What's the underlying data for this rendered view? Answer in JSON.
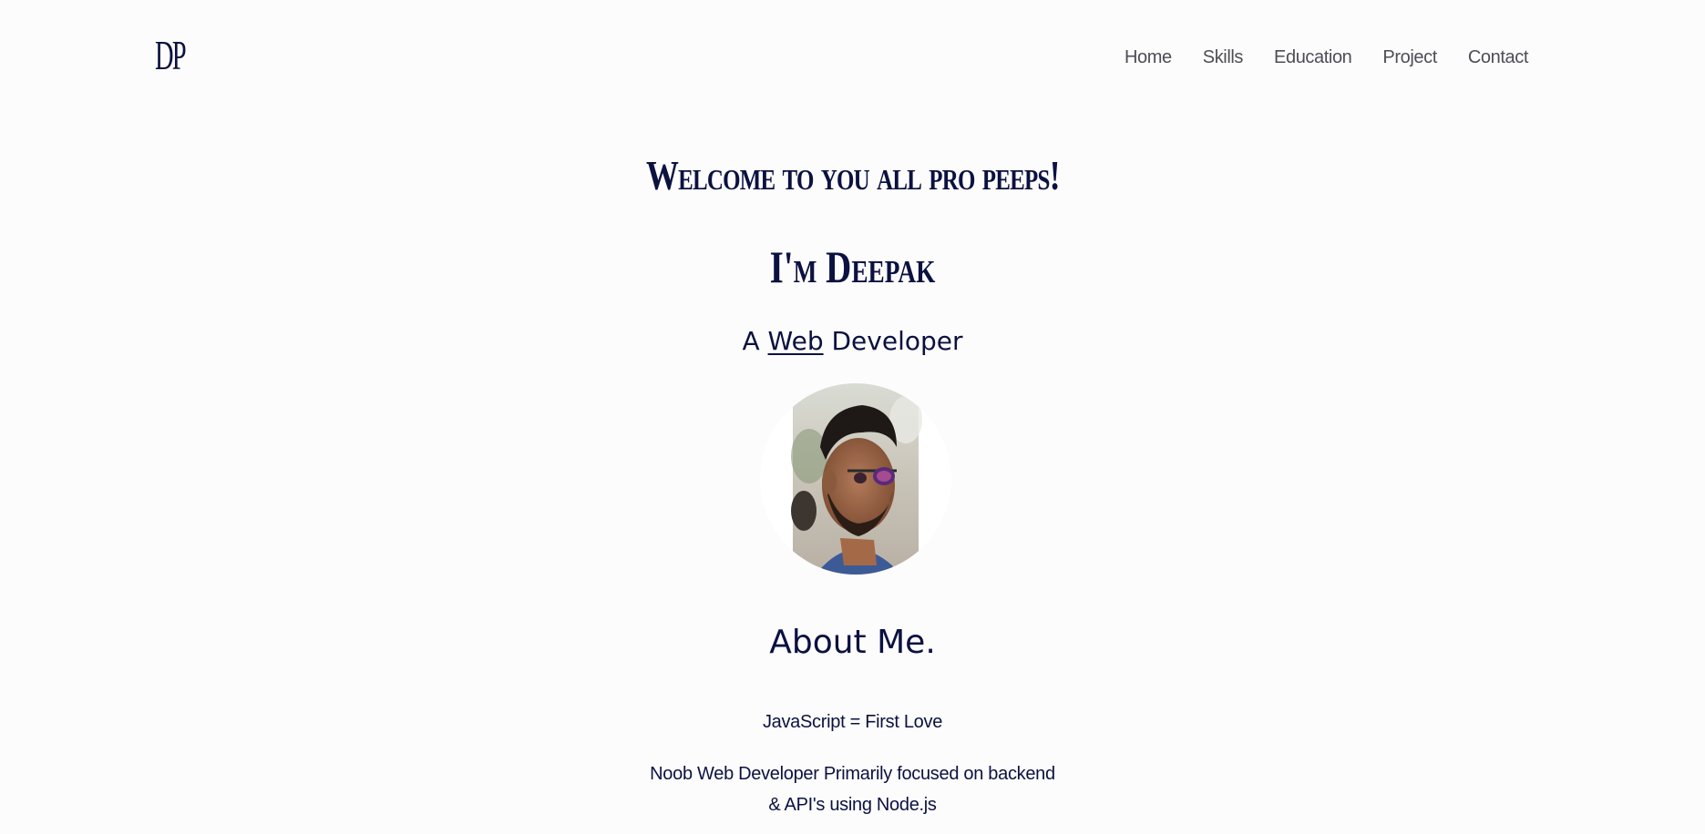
{
  "header": {
    "logo": "DP",
    "nav": [
      "Home",
      "Skills",
      "Education",
      "Project",
      "Contact"
    ]
  },
  "hero": {
    "welcome": "Welcome to you all pro peeps!",
    "name": "I'm Deepak",
    "tagline_prefix": "A",
    "tagline_highlight": "Web",
    "tagline_suffix": "Developer"
  },
  "about": {
    "title": "About Me.",
    "line1": "JavaScript = First Love",
    "line2": "Noob Web Developer Primarily focused on backend",
    "line3": "& API's using Node.js"
  },
  "colors": {
    "background": "#fcfcfc",
    "primary_text": "#0b1140",
    "nav_text": "#4d4d56"
  }
}
